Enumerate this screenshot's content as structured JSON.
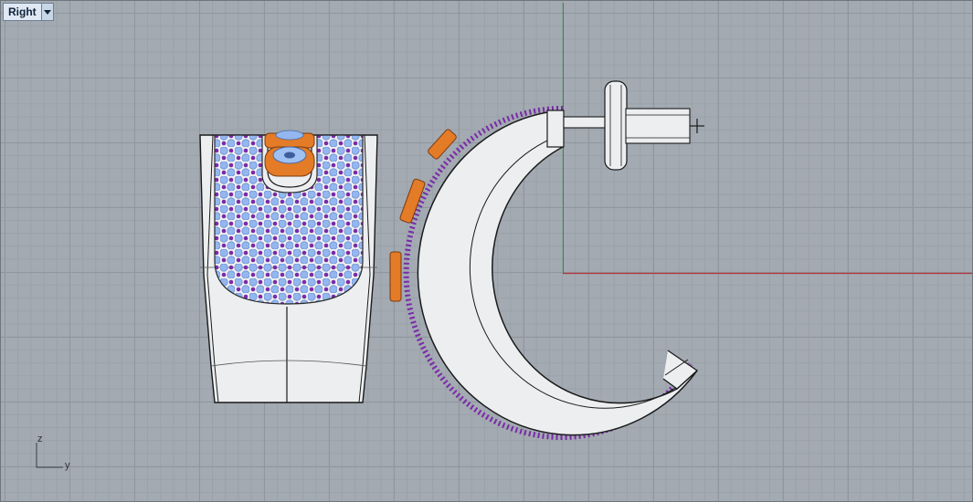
{
  "viewport": {
    "name": "Right",
    "axis_labels": {
      "vertical": "z",
      "horizontal": "y"
    }
  },
  "colors": {
    "background": "#a3aab2",
    "grid_major": "#8f969e",
    "grid_minor": "#9aa1a9",
    "x_axis": "#b4323a",
    "z_axis": "#1f9a2a",
    "metal": "#eceef0",
    "gem_blue": "#94b7f0",
    "gem_purple": "#7a2aa8",
    "orange": "#e37b27"
  },
  "icons": {
    "dropdown": "chevron-down-icon",
    "axis_gizmo": "axis-icon"
  }
}
